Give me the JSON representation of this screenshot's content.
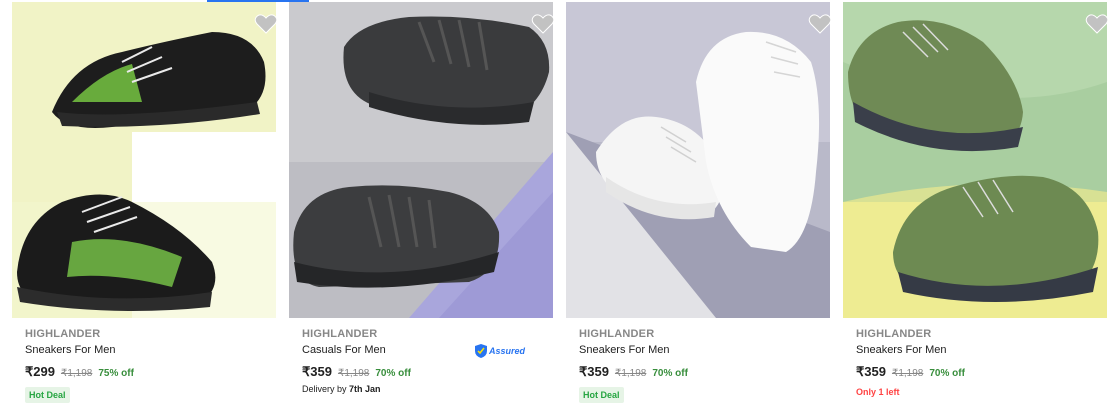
{
  "products": [
    {
      "brand": "HIGHLANDER",
      "title": "Sneakers For Men",
      "price": "₹299",
      "mrp": "₹1,198",
      "discount": "75% off",
      "tag": "Hot Deal"
    },
    {
      "brand": "HIGHLANDER",
      "title": "Casuals For Men",
      "price": "₹359",
      "mrp": "₹1,198",
      "discount": "70% off",
      "assured": "Assured",
      "delivery_prefix": "Delivery by ",
      "delivery_date": "7th Jan"
    },
    {
      "brand": "HIGHLANDER",
      "title": "Sneakers For Men",
      "price": "₹359",
      "mrp": "₹1,198",
      "discount": "70% off",
      "tag": "Hot Deal"
    },
    {
      "brand": "HIGHLANDER",
      "title": "Sneakers For Men",
      "price": "₹359",
      "mrp": "₹1,198",
      "discount": "70% off",
      "stock": "Only 1 left"
    }
  ],
  "colors": {
    "accent": "#2874f0",
    "discount": "#388e3c",
    "deal_bg": "#e6f4e6",
    "stock_alert": "#ff4343"
  }
}
